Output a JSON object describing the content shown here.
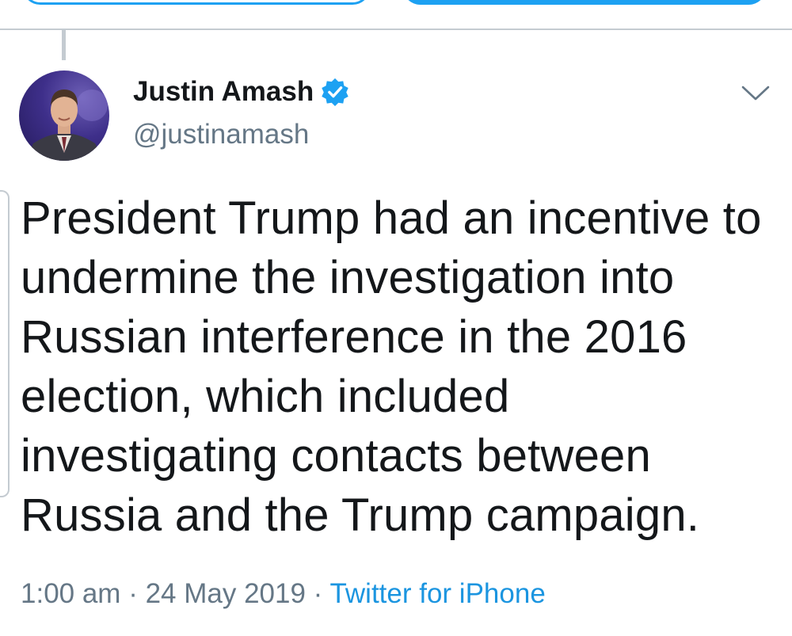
{
  "author": {
    "name": "Justin Amash",
    "handle": "@justinamash",
    "verified": true
  },
  "tweet": {
    "lines": [
      "President Trump had an incentive to",
      "undermine the investigation into",
      "Russian interference in the 2016",
      "election, which included",
      "investigating contacts between",
      "Russia and the Trump campaign."
    ]
  },
  "meta": {
    "time": "1:00 am",
    "separator1": " · ",
    "date": "24 May 2019",
    "separator2": " · ",
    "source": "Twitter for iPhone"
  },
  "colors": {
    "accent": "#1da1f2",
    "link": "#1b95e0",
    "secondary_text": "#657786",
    "primary_text": "#14171a",
    "divider": "#c4cbd1"
  },
  "icons": {
    "verified": "verified-badge-icon",
    "menu": "chevron-down-icon"
  }
}
